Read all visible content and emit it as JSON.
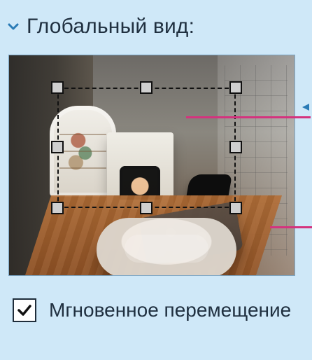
{
  "header": {
    "title": "Глобальный вид:",
    "chevron_icon": "chevron-down-icon"
  },
  "view": {
    "image_icon": "room-preview-image",
    "selection": {
      "state": "selected-region"
    },
    "callouts": {
      "color": "#d4337e"
    }
  },
  "instant_move": {
    "checked": true,
    "label": "Мгновенное перемещение",
    "checkbox_icon": "checkbox-checked-icon"
  },
  "colors": {
    "panel_bg": "#cfe8f8",
    "text": "#203040",
    "accent_magenta": "#d4337e"
  }
}
